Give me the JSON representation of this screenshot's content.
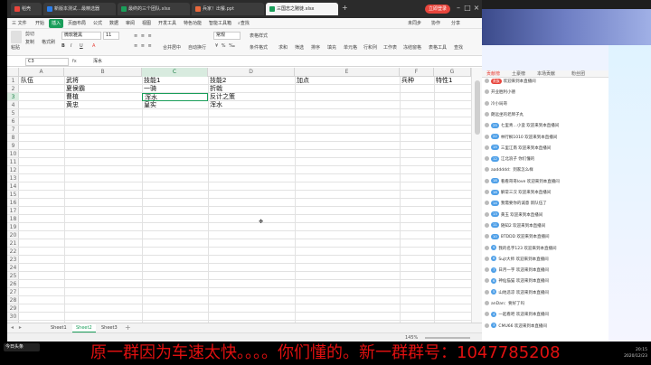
{
  "titlebar": {
    "tabs": [
      {
        "label": "稻壳",
        "icon_color": "#e8453c"
      },
      {
        "label": "新版本测试…最精选器",
        "icon_color": "#2b7de9"
      },
      {
        "label": "最终的三个团队.xlsx",
        "icon_color": "#1a9e5a"
      },
      {
        "label": "兵家！出餐.ppt",
        "icon_color": "#e8683c"
      },
      {
        "label": "三国志之赌徒.xlsx",
        "icon_color": "#1a9e5a"
      }
    ],
    "login_label": "立即登录"
  },
  "menubar": {
    "items": [
      "三 文件",
      "开始",
      "插入",
      "页面布局",
      "公式",
      "数据",
      "审阅",
      "视图",
      "开发工具",
      "特色功能",
      "智能工具箱",
      "查找"
    ],
    "active_index": 1,
    "right_items": [
      "未同步",
      "协作",
      "分享"
    ]
  },
  "ribbon": {
    "paste_label": "粘贴",
    "cut_label": "剪切",
    "copy_label": "复制",
    "format_label": "格式刷",
    "font_name": "微软雅黑",
    "font_size": "11",
    "merge_label": "合并居中",
    "wrap_label": "自动换行",
    "number_format": "常规",
    "cond_label": "条件格式",
    "table_label": "表格样式",
    "sum_label": "求和",
    "filter_label": "筛选",
    "sort_label": "排序",
    "fill_label": "填充",
    "cell_label": "单元格",
    "rowcol_label": "行和列",
    "sheet_label": "工作表",
    "freeze_label": "冻结窗格",
    "tabletools_label": "表格工具",
    "find_label": "查找"
  },
  "formula_bar": {
    "name_box": "C3",
    "fx_label": "fx",
    "value": "浑水"
  },
  "grid": {
    "columns": [
      "A",
      "B",
      "C",
      "D",
      "E",
      "F",
      "G"
    ],
    "selected_column": "C",
    "rows": [
      "1",
      "2",
      "3",
      "4",
      "5",
      "6",
      "7",
      "8",
      "9",
      "10",
      "11",
      "12",
      "13",
      "14",
      "15",
      "16",
      "17",
      "18",
      "19",
      "20",
      "21",
      "22",
      "23",
      "24",
      "25",
      "26",
      "27",
      "28",
      "29",
      "30"
    ],
    "selected_row": "3",
    "cells": {
      "A1": "队伍",
      "B1": "武将",
      "C1": "技能1",
      "D1": "技能2",
      "E1": "加点",
      "F1": "兵种",
      "G1": "特性1",
      "B2": "夏侯霸",
      "C2": "一骑",
      "D2": "折戟",
      "B3": "曹植",
      "C3": "浑水",
      "D3": "反计之策",
      "B4": "黄忠",
      "C4": "皇实",
      "D4": "浑水"
    }
  },
  "sheets": {
    "tabs": [
      "Sheet1",
      "Sheet2",
      "Sheet3"
    ],
    "active_index": 1,
    "zoom": "145%"
  },
  "chat": {
    "tabs": [
      "贡献榜",
      "土豪榜",
      "本场贡献",
      "粉丝团"
    ],
    "active_index": 0,
    "messages": [
      {
        "badge": "贵族",
        "badge_color": "#e8453c",
        "text": "欢迎来到本直播间"
      },
      {
        "badge": "",
        "badge_color": "#f0a020",
        "text": "开业胜利小德"
      },
      {
        "badge": "",
        "badge_color": "#f0a020",
        "text": "冷小局哥"
      },
      {
        "badge": "",
        "badge_color": "#f0a020",
        "text": "朗远坐的老牌子丸"
      },
      {
        "badge": "25",
        "badge_color": "#4fa0e8",
        "text": "七里青…小蛮 欢迎来到本直播间"
      },
      {
        "badge": "22",
        "badge_color": "#4fa0e8",
        "text": "林行枫1010 欢迎来到本直播间"
      },
      {
        "badge": "15",
        "badge_color": "#4fa0e8",
        "text": "三里江南 欢迎来到本直播间"
      },
      {
        "badge": "12",
        "badge_color": "#4fa0e8",
        "text": "江北浪子 你们懂的"
      },
      {
        "badge": "",
        "badge_color": "#999",
        "text": "aaddddd：到家怎么样"
      },
      {
        "badge": "18",
        "badge_color": "#4fa0e8",
        "text": "看看哥哥love 欢迎来到本直播间"
      },
      {
        "badge": "16",
        "badge_color": "#4fa0e8",
        "text": "解常三汉 欢迎来到本直播间"
      },
      {
        "badge": "14",
        "badge_color": "#4fa0e8",
        "text": "我需要你的诚意 新队伍了"
      },
      {
        "badge": "13",
        "badge_color": "#4fa0e8",
        "text": "黄玉 欢迎来到本直播间"
      },
      {
        "badge": "11",
        "badge_color": "#4fa0e8",
        "text": "随知2 欢迎来到本直播间"
      },
      {
        "badge": "10",
        "badge_color": "#4fa0e8",
        "text": "BTDDD 欢迎来到本直播间"
      },
      {
        "badge": "9",
        "badge_color": "#4fa0e8",
        "text": "我的名字123 欢迎来到本直播间"
      },
      {
        "badge": "8",
        "badge_color": "#4fa0e8",
        "text": "Sujt大师 欢迎来到本直播间"
      },
      {
        "badge": "7",
        "badge_color": "#4fa0e8",
        "text": "日月一字 欢迎来到本直播间"
      },
      {
        "badge": "6",
        "badge_color": "#4fa0e8",
        "text": "神仙猫猫 欢迎来到本直播间"
      },
      {
        "badge": "5",
        "badge_color": "#4fa0e8",
        "text": "山地悲凉 欢迎来到本直播间"
      },
      {
        "badge": "",
        "badge_color": "#999",
        "text": "anDan：要好了吗"
      },
      {
        "badge": "4",
        "badge_color": "#4fa0e8",
        "text": "一起看吧 欢迎来到本直播间"
      },
      {
        "badge": "3",
        "badge_color": "#4fa0e8",
        "text": "CMU66 欢迎来到本直播间"
      }
    ]
  },
  "banner": {
    "text": "原一群因为车速太快。。。。你们懂的。新一群群号：1047785208"
  },
  "system": {
    "tray_label": "今日头条",
    "time": "20:15",
    "date": "2020/12/23"
  }
}
